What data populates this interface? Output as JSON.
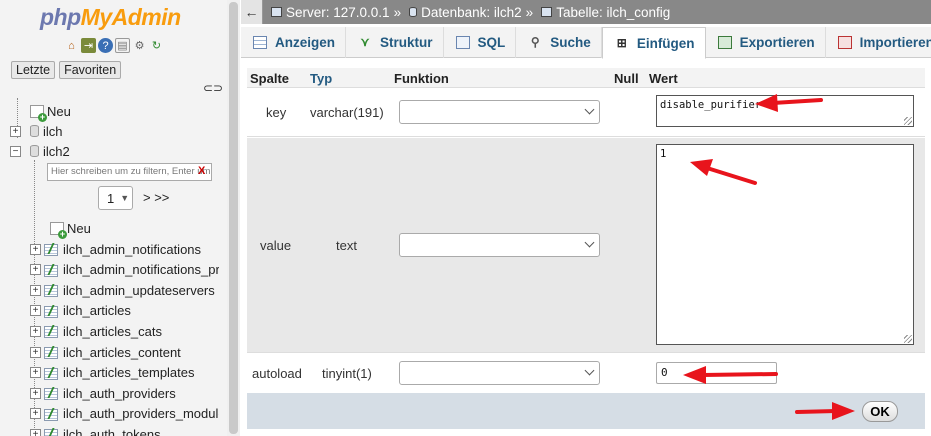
{
  "logo": {
    "php": "php",
    "myadmin": "MyAdmin"
  },
  "sidebar": {
    "icons": [
      "home-icon",
      "logout-icon",
      "help-icon",
      "docs-icon",
      "settings-icon",
      "reload-icon"
    ],
    "tabs": [
      "Letzte",
      "Favoriten"
    ],
    "tree_top": [
      {
        "label": "Neu",
        "kind": "new"
      },
      {
        "label": "ilch",
        "kind": "db",
        "expander": "+"
      },
      {
        "label": "ilch2",
        "kind": "db",
        "expander": "−"
      }
    ],
    "filter_placeholder": "Hier schreiben um zu filtern, Enter um alle",
    "filter_clear": "X",
    "page_value": "1",
    "next_pages": "> >>",
    "tables_new": "Neu",
    "tables": [
      "ilch_admin_notifications",
      "ilch_admin_notifications_provider",
      "ilch_admin_updateservers",
      "ilch_articles",
      "ilch_articles_cats",
      "ilch_articles_content",
      "ilch_articles_templates",
      "ilch_auth_providers",
      "ilch_auth_providers_modules",
      "ilch_auth_tokens"
    ]
  },
  "breadcrumb": {
    "collapse": "←",
    "server": "Server: 127.0.0.1",
    "database": "Datenbank: ilch2",
    "table": "Tabelle: ilch_config",
    "sep": "»"
  },
  "tabs": [
    {
      "label": "Anzeigen",
      "icon": "browse-icon",
      "active": false
    },
    {
      "label": "Struktur",
      "icon": "structure-icon",
      "active": false
    },
    {
      "label": "SQL",
      "icon": "sql-icon",
      "active": false
    },
    {
      "label": "Suche",
      "icon": "search-icon",
      "active": false
    },
    {
      "label": "Einfügen",
      "icon": "insert-icon",
      "active": true
    },
    {
      "label": "Exportieren",
      "icon": "export-icon",
      "active": false
    },
    {
      "label": "Importieren",
      "icon": "import-icon",
      "active": false
    }
  ],
  "insert_form": {
    "headers": {
      "column": "Spalte",
      "type": "Typ",
      "function": "Funktion",
      "null": "Null",
      "value": "Wert"
    },
    "rows": [
      {
        "column": "key",
        "type": "varchar(191)",
        "function": "",
        "value": "disable_purifier"
      },
      {
        "column": "value",
        "type": "text",
        "function": "",
        "value": "1"
      },
      {
        "column": "autoload",
        "type": "tinyint(1)",
        "function": "",
        "value": "0"
      }
    ],
    "ok_label": "OK"
  },
  "colors": {
    "accent_link": "#235a81",
    "breadcrumb_bg": "#888888",
    "annotation_arrow": "#e8141c",
    "footer_bg": "#d5dde5"
  }
}
